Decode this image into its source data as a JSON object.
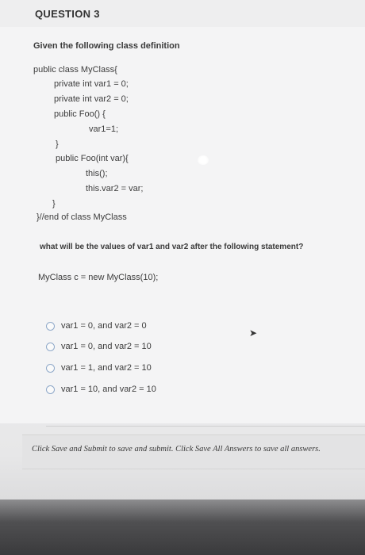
{
  "question": {
    "number_label": "QUESTION 3",
    "prompt": "Given the following class definition",
    "code_lines": [
      "public class MyClass{",
      "private int var1 = 0;",
      "private int var2 = 0;",
      "public Foo() {",
      "var1=1;",
      "}",
      "public Foo(int var){",
      "this();",
      "this.var2 = var;",
      "}",
      "}//end of class MyClass"
    ],
    "question_text": "what will be the values of var1 and var2 after the following statement?",
    "statement": "MyClass c = new MyClass(10);",
    "options": [
      "var1 = 0, and var2 = 0",
      "var1 = 0, and var2 = 10",
      "var1 = 1, and var2 = 10",
      "var1 = 10, and var2 = 10"
    ]
  },
  "footer": {
    "text": "Click Save and Submit to save and submit. Click Save All Answers to save all answers."
  }
}
